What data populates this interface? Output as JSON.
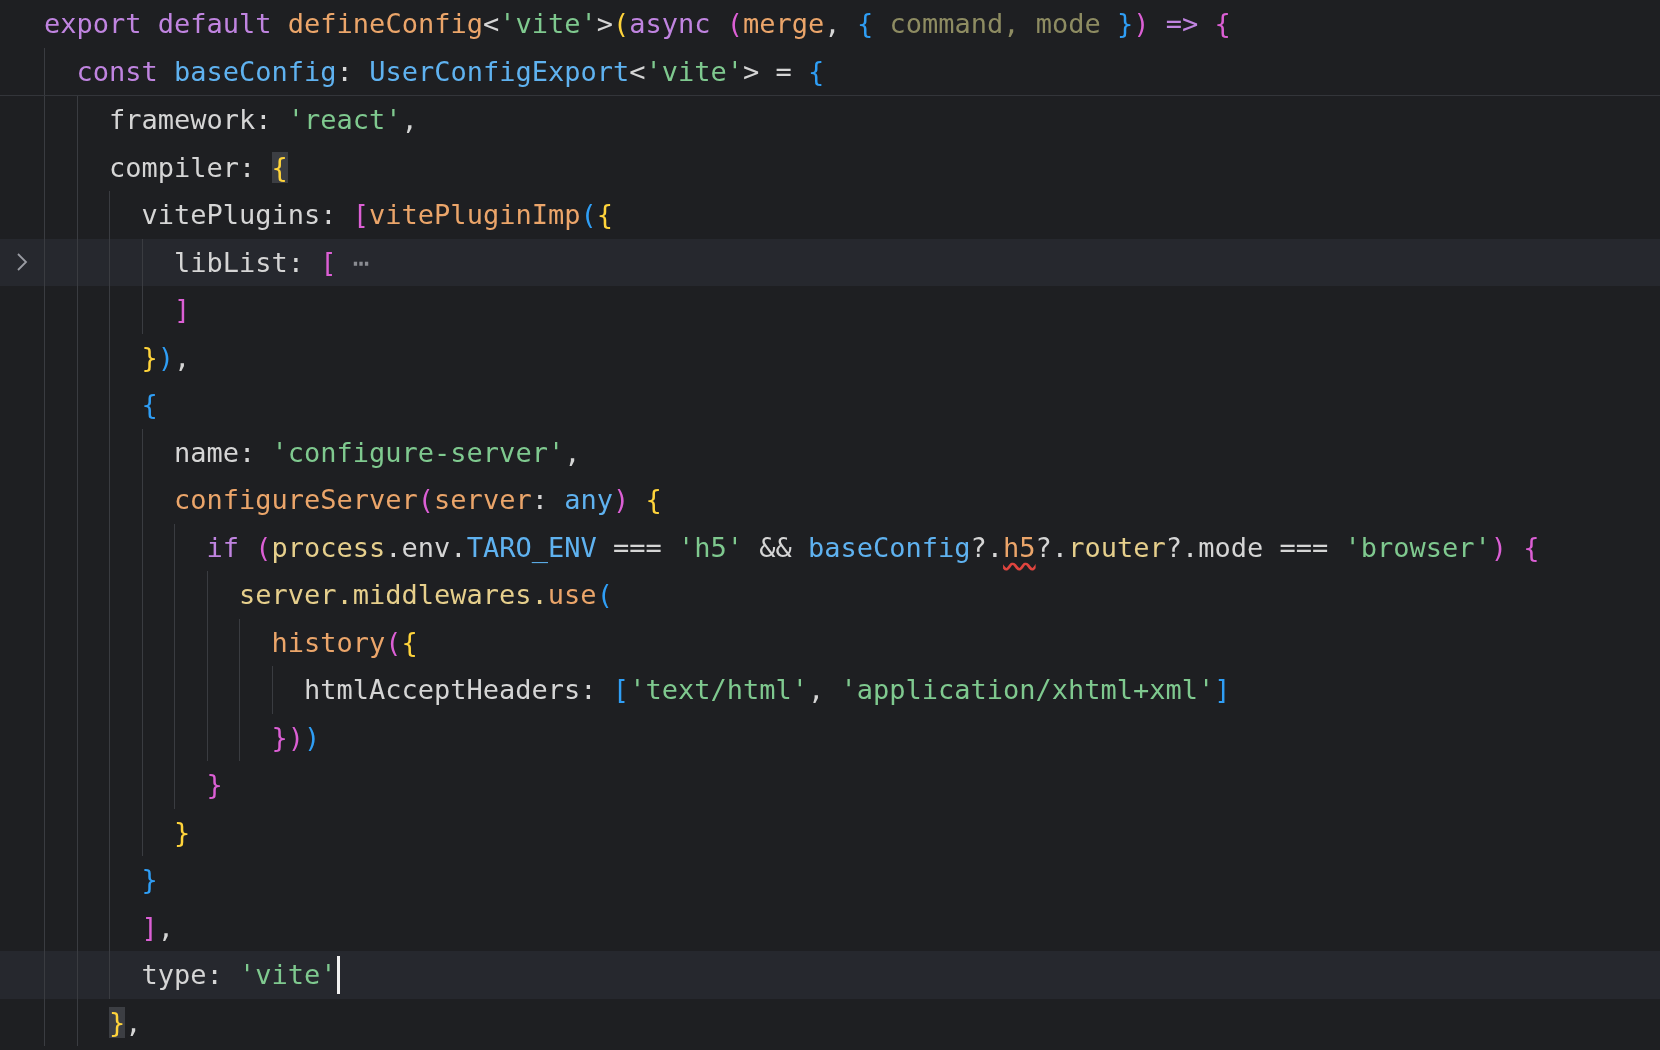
{
  "sticky_header": [
    {
      "tokens": [
        {
          "kind": "keyword",
          "text": "export default "
        },
        {
          "kind": "function",
          "text": "defineConfig"
        },
        {
          "kind": "plain",
          "text": "<"
        },
        {
          "kind": "string",
          "text": "'vite'"
        },
        {
          "kind": "plain",
          "text": ">"
        },
        {
          "kind": "bracket1",
          "text": "("
        },
        {
          "kind": "keyword",
          "text": "async "
        },
        {
          "kind": "bracket2",
          "text": "("
        },
        {
          "kind": "param",
          "text": "merge"
        },
        {
          "kind": "plain",
          "text": ", "
        },
        {
          "kind": "bracket3",
          "text": "{ "
        },
        {
          "kind": "unused",
          "text": "command, mode"
        },
        {
          "kind": "bracket3",
          "text": " }"
        },
        {
          "kind": "bracket2",
          "text": ")"
        },
        {
          "kind": "keyword",
          "text": " => "
        },
        {
          "kind": "bracket2",
          "text": "{"
        }
      ],
      "children": [
        {
          "tokens": [
            {
              "kind": "keyword",
              "text": "const "
            },
            {
              "kind": "type",
              "text": "baseConfig"
            },
            {
              "kind": "plain",
              "text": ": "
            },
            {
              "kind": "type",
              "text": "UserConfigExport"
            },
            {
              "kind": "plain",
              "text": "<"
            },
            {
              "kind": "string",
              "text": "'vite'"
            },
            {
              "kind": "plain",
              "text": "> = "
            },
            {
              "kind": "bracket3",
              "text": "{"
            }
          ]
        }
      ]
    }
  ],
  "lines": [
    {
      "highlighted": false,
      "folded": false,
      "cursor": false,
      "tokens": [
        {
          "kind": "plain",
          "text": "framework: "
        },
        {
          "kind": "string",
          "text": "'react'"
        },
        {
          "kind": "plain",
          "text": ","
        }
      ]
    },
    {
      "highlighted": false,
      "folded": false,
      "cursor": false,
      "tokens": [
        {
          "kind": "plain",
          "text": "compiler: "
        },
        {
          "kind": "bracket1-match",
          "text": "{"
        }
      ],
      "children": [
        {
          "highlighted": false,
          "folded": false,
          "cursor": false,
          "tokens": [
            {
              "kind": "plain",
              "text": "vitePlugins: "
            },
            {
              "kind": "bracket2",
              "text": "["
            },
            {
              "kind": "function",
              "text": "vitePluginImp"
            },
            {
              "kind": "bracket3",
              "text": "("
            },
            {
              "kind": "bracket1",
              "text": "{"
            }
          ],
          "children": [
            {
              "highlighted": true,
              "folded": true,
              "cursor": false,
              "tokens": [
                {
                  "kind": "plain",
                  "text": "libList: "
                },
                {
                  "kind": "bracket2",
                  "text": "["
                },
                {
                  "kind": "fold",
                  "text": " ⋯"
                }
              ]
            },
            {
              "highlighted": false,
              "folded": false,
              "cursor": false,
              "tokens": [
                {
                  "kind": "bracket2",
                  "text": "]"
                }
              ]
            }
          ]
        },
        {
          "highlighted": false,
          "folded": false,
          "cursor": false,
          "tokens": [
            {
              "kind": "bracket1",
              "text": "}"
            },
            {
              "kind": "bracket3",
              "text": ")"
            },
            {
              "kind": "plain",
              "text": ","
            }
          ]
        },
        {
          "highlighted": false,
          "folded": false,
          "cursor": false,
          "tokens": [
            {
              "kind": "bracket3",
              "text": "{"
            }
          ],
          "children": [
            {
              "highlighted": false,
              "folded": false,
              "cursor": false,
              "tokens": [
                {
                  "kind": "plain",
                  "text": "name: "
                },
                {
                  "kind": "string",
                  "text": "'configure-server'"
                },
                {
                  "kind": "plain",
                  "text": ","
                }
              ]
            },
            {
              "highlighted": false,
              "folded": false,
              "cursor": false,
              "tokens": [
                {
                  "kind": "function",
                  "text": "configureServer"
                },
                {
                  "kind": "bracket2",
                  "text": "("
                },
                {
                  "kind": "param",
                  "text": "server"
                },
                {
                  "kind": "plain",
                  "text": ": "
                },
                {
                  "kind": "type",
                  "text": "any"
                },
                {
                  "kind": "bracket2",
                  "text": ")"
                },
                {
                  "kind": "bracket1",
                  "text": " {"
                }
              ],
              "children": [
                {
                  "highlighted": false,
                  "folded": false,
                  "cursor": false,
                  "tokens": [
                    {
                      "kind": "keyword",
                      "text": "if "
                    },
                    {
                      "kind": "bracket2",
                      "text": "("
                    },
                    {
                      "kind": "variable",
                      "text": "process"
                    },
                    {
                      "kind": "plain",
                      "text": ".env."
                    },
                    {
                      "kind": "type",
                      "text": "TARO_ENV"
                    },
                    {
                      "kind": "plain",
                      "text": " === "
                    },
                    {
                      "kind": "string",
                      "text": "'h5'"
                    },
                    {
                      "kind": "plain",
                      "text": " && "
                    },
                    {
                      "kind": "type",
                      "text": "baseConfig"
                    },
                    {
                      "kind": "plain",
                      "text": "?."
                    },
                    {
                      "kind": "error",
                      "text": "h5"
                    },
                    {
                      "kind": "plain",
                      "text": "?."
                    },
                    {
                      "kind": "variable",
                      "text": "router"
                    },
                    {
                      "kind": "plain",
                      "text": "?.mode === "
                    },
                    {
                      "kind": "string",
                      "text": "'browser'"
                    },
                    {
                      "kind": "bracket2",
                      "text": ")"
                    },
                    {
                      "kind": "bracket2",
                      "text": " {"
                    }
                  ],
                  "children": [
                    {
                      "highlighted": false,
                      "folded": false,
                      "cursor": false,
                      "tokens": [
                        {
                          "kind": "variable",
                          "text": "server.middlewares."
                        },
                        {
                          "kind": "function",
                          "text": "use"
                        },
                        {
                          "kind": "bracket3",
                          "text": "("
                        }
                      ],
                      "children": [
                        {
                          "highlighted": false,
                          "folded": false,
                          "cursor": false,
                          "tokens": [
                            {
                              "kind": "function",
                              "text": "history"
                            },
                            {
                              "kind": "bracket2",
                              "text": "("
                            },
                            {
                              "kind": "bracket1",
                              "text": "{"
                            }
                          ],
                          "children": [
                            {
                              "highlighted": false,
                              "folded": false,
                              "cursor": false,
                              "tokens": [
                                {
                                  "kind": "plain",
                                  "text": "htmlAcceptHeaders: "
                                },
                                {
                                  "kind": "bracket3",
                                  "text": "["
                                },
                                {
                                  "kind": "string",
                                  "text": "'text/html'"
                                },
                                {
                                  "kind": "plain",
                                  "text": ", "
                                },
                                {
                                  "kind": "string",
                                  "text": "'application/xhtml+xml'"
                                },
                                {
                                  "kind": "bracket3",
                                  "text": "]"
                                }
                              ]
                            }
                          ]
                        },
                        {
                          "highlighted": false,
                          "folded": false,
                          "cursor": false,
                          "tokens": [
                            {
                              "kind": "bracket2",
                              "text": "}"
                            },
                            {
                              "kind": "bracket2",
                              "text": ")"
                            },
                            {
                              "kind": "bracket3",
                              "text": ")"
                            }
                          ]
                        }
                      ]
                    }
                  ]
                },
                {
                  "highlighted": false,
                  "folded": false,
                  "cursor": false,
                  "tokens": [
                    {
                      "kind": "bracket2",
                      "text": "}"
                    }
                  ]
                }
              ]
            },
            {
              "highlighted": false,
              "folded": false,
              "cursor": false,
              "tokens": [
                {
                  "kind": "bracket1",
                  "text": "}"
                }
              ]
            }
          ]
        },
        {
          "highlighted": false,
          "folded": false,
          "cursor": false,
          "tokens": [
            {
              "kind": "bracket3",
              "text": "}"
            }
          ]
        },
        {
          "highlighted": false,
          "folded": false,
          "cursor": false,
          "tokens": [
            {
              "kind": "bracket2",
              "text": "]"
            },
            {
              "kind": "plain",
              "text": ","
            }
          ]
        },
        {
          "highlighted": true,
          "folded": false,
          "cursor": true,
          "tokens": [
            {
              "kind": "plain",
              "text": "type: "
            },
            {
              "kind": "string",
              "text": "'vite'"
            }
          ]
        }
      ]
    },
    {
      "highlighted": false,
      "folded": false,
      "cursor": false,
      "tokens": [
        {
          "kind": "bracket1-match",
          "text": "}"
        },
        {
          "kind": "plain",
          "text": ","
        }
      ]
    }
  ]
}
